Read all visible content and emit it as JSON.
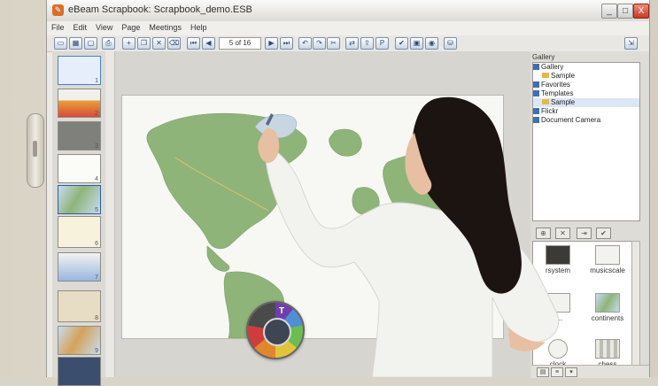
{
  "window": {
    "title": "eBeam Scrapbook: Scrapbook_demo.ESB",
    "app_icon": "scrapbook-icon",
    "minimize": "_",
    "maximize": "□",
    "close": "X"
  },
  "menu": [
    "File",
    "Edit",
    "View",
    "Page",
    "Meetings",
    "Help"
  ],
  "toolbar": {
    "page_indicator": "5 of 16",
    "icons": [
      "view-icon",
      "grid-icon",
      "panel-icon",
      "print-icon",
      "new-page-icon",
      "copy-icon",
      "delete-icon",
      "clear-icon",
      "first-page-icon",
      "prev-page-icon",
      "next-page-icon",
      "last-page-icon",
      "undo-icon",
      "redo-icon",
      "cut-icon",
      "share-icon",
      "export-icon",
      "pdf-icon",
      "check-icon",
      "screen-icon",
      "camera-icon",
      "bag-icon",
      "expand-icon"
    ]
  },
  "thumbnails": [
    {
      "num": "1"
    },
    {
      "num": "2"
    },
    {
      "num": "3"
    },
    {
      "num": "4"
    },
    {
      "num": "5"
    },
    {
      "num": "6"
    },
    {
      "num": "7"
    },
    {
      "num": "8"
    },
    {
      "num": "9"
    }
  ],
  "gallery": {
    "header": "Gallery",
    "tree": [
      {
        "label": "Gallery",
        "type": "checkbox",
        "level": 0
      },
      {
        "label": "Sample",
        "type": "folder",
        "level": 1
      },
      {
        "label": "Favorites",
        "type": "checkbox",
        "level": 0
      },
      {
        "label": "Templates",
        "type": "checkbox",
        "level": 0
      },
      {
        "label": "Sample",
        "type": "folder",
        "level": 1
      },
      {
        "label": "Flickr",
        "type": "checkbox",
        "level": 0
      },
      {
        "label": "Document Camera",
        "type": "checkbox",
        "level": 0
      }
    ],
    "items": [
      {
        "label": "rsystem"
      },
      {
        "label": "musicscale"
      },
      {
        "label": "c..."
      },
      {
        "label": "continents"
      },
      {
        "label": "clock"
      },
      {
        "label": "chess"
      }
    ]
  },
  "colors": {
    "map_land": "#8fb47a",
    "map_water": "#f7f7f3",
    "accent": "#3f6fb3"
  }
}
